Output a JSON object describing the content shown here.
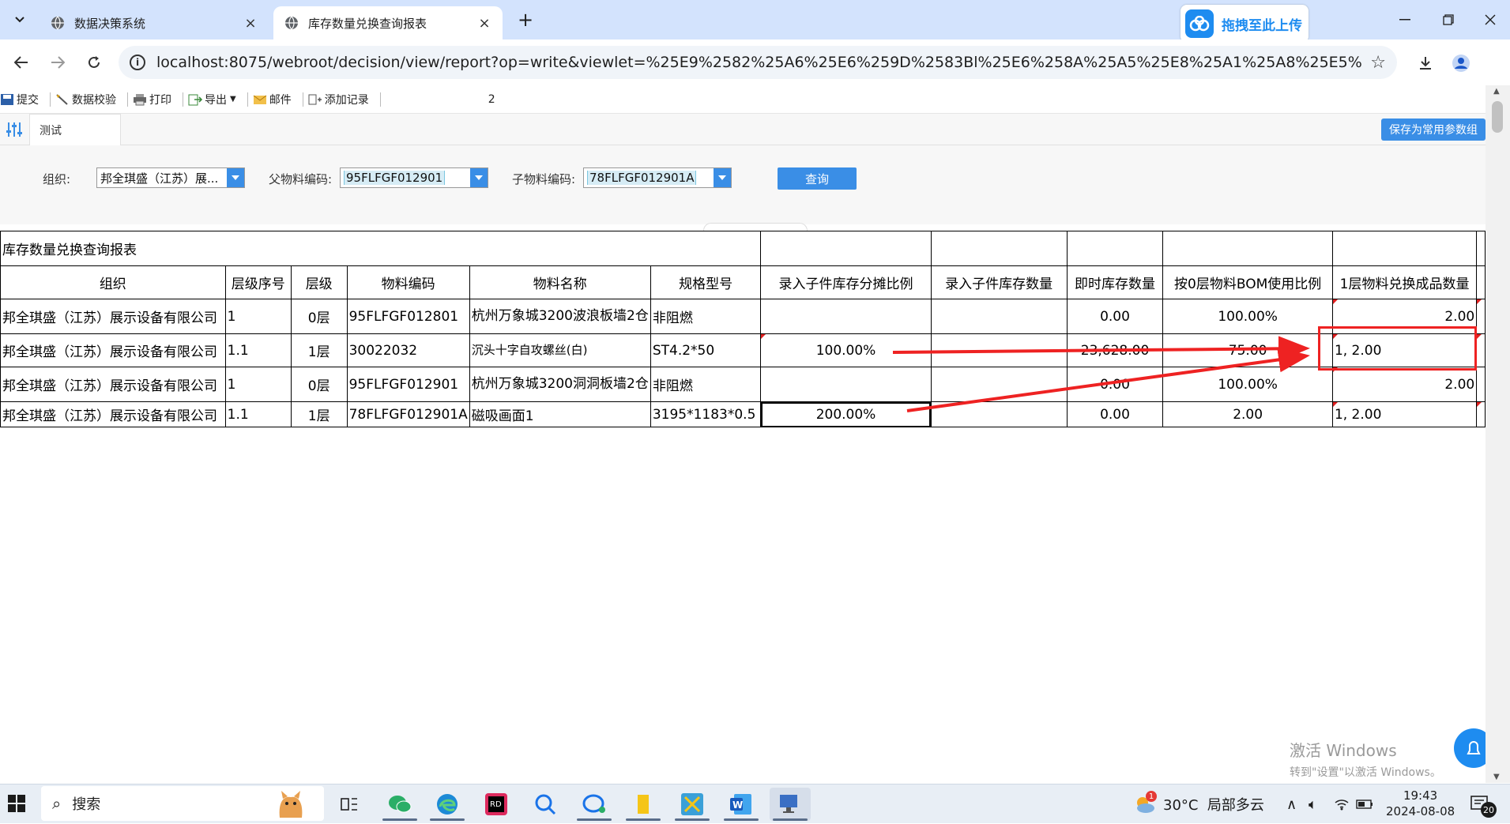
{
  "browser": {
    "tabs": [
      {
        "title": "数据决策系统",
        "active": false
      },
      {
        "title": "库存数量兑换查询报表",
        "active": true
      }
    ],
    "url": "localhost:8075/webroot/decision/view/report?op=write&viewlet=%25E9%2582%25A6%25E6%259D%2583Bl%25E6%258A%25A5%25E8%25A1%25A8%25E5%25BC%2580%25E5%...",
    "upload_label": "拖拽至此上传"
  },
  "report_toolbar": {
    "items": [
      "提交",
      "数据校验",
      "打印",
      "导出",
      "邮件",
      "添加记录"
    ],
    "count": "2"
  },
  "param_panel": {
    "tab_label": "测试",
    "save_label": "保存为常用参数组",
    "org_label": "组织:",
    "org_value": "邦全琪盛（江苏）展...",
    "parent_label": "父物料编码:",
    "parent_value": "95FLFGF012901",
    "child_label": "子物料编码:",
    "child_value": "78FLFGF012901A",
    "query_label": "查询"
  },
  "report": {
    "title": "库存数量兑换查询报表",
    "headers": [
      "组织",
      "层级序号",
      "层级",
      "物料编码",
      "物料名称",
      "规格型号",
      "录入子件库存分摊比例",
      "录入子件库存数量",
      "即时库存数量",
      "按0层物料BOM使用比例",
      "1层物料兑换成品数量"
    ],
    "rows": [
      [
        "邦全琪盛（江苏）展示设备有限公司",
        "1",
        "0层",
        "95FLFGF012801",
        "杭州万象城3200波浪板墙2仓",
        "非阻燃",
        "",
        "",
        "0.00",
        "100.00%",
        "2.00"
      ],
      [
        "邦全琪盛（江苏）展示设备有限公司",
        "1.1",
        "1层",
        "30022032",
        "沉头十字自攻螺丝(白)",
        "ST4.2*50",
        "100.00%",
        "",
        "23,628.00",
        "75.00",
        "1, 2.00"
      ],
      [
        "邦全琪盛（江苏）展示设备有限公司",
        "1",
        "0层",
        "95FLFGF012901",
        "杭州万象城3200洞洞板墙2仓",
        "非阻燃",
        "",
        "",
        "0.00",
        "100.00%",
        "2.00"
      ],
      [
        "邦全琪盛（江苏）展示设备有限公司",
        "1.1",
        "1层",
        "78FLFGF012901A",
        "磁吸画面1",
        "3195*1183*0.5",
        "200.00%",
        "",
        "0.00",
        "2.00",
        "1, 2.00"
      ]
    ]
  },
  "watermark": {
    "line1": "激活 Windows",
    "line2": "转到\"设置\"以激活 Windows。"
  },
  "taskbar": {
    "search_placeholder": "搜索",
    "weather": "30°C  局部多云",
    "weather_badge": "1",
    "time": "19:43",
    "date": "2024-08-08",
    "notifications": "20"
  },
  "colors": {
    "accent": "#3a8ee6",
    "annotation_red": "#ee2222",
    "tabstrip": "#d3e3fd"
  }
}
